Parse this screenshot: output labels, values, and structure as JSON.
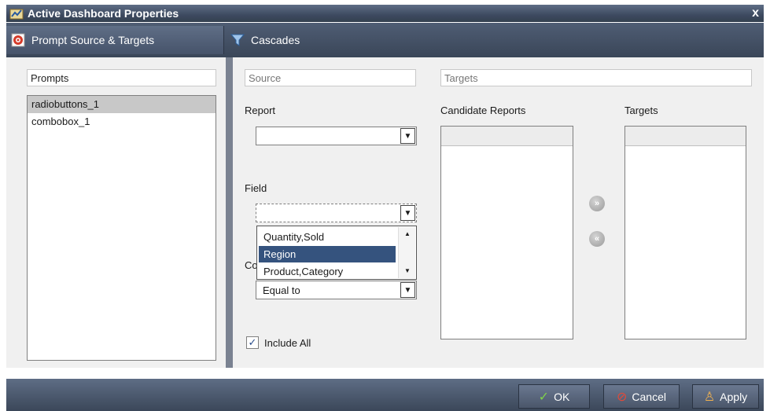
{
  "window": {
    "title": "Active Dashboard Properties",
    "close_glyph": "x"
  },
  "tabs": [
    {
      "label": "Prompt Source & Targets",
      "icon": "target-icon",
      "active": true
    },
    {
      "label": "Cascades",
      "icon": "funnel-icon",
      "active": false
    }
  ],
  "prompts": {
    "header": "Prompts",
    "items": [
      "radiobuttons_1",
      "combobox_1"
    ],
    "selected": "radiobuttons_1"
  },
  "source": {
    "header": "Source",
    "report_label": "Report",
    "report_value": "",
    "field_label": "Field",
    "field_value": "",
    "field_options": [
      "Quantity,Sold",
      "Region",
      "Product,Category"
    ],
    "field_highlighted": "Region",
    "condition_label_partial": "Co",
    "condition_value": "Equal to",
    "include_all_label": "Include All",
    "include_all_checked": true,
    "arrow_glyph": "▼",
    "scroll_up_glyph": "▲",
    "scroll_down_glyph": "▼",
    "check_glyph": "✓"
  },
  "targets": {
    "header": "Targets",
    "candidate_label": "Candidate Reports",
    "targets_label": "Targets",
    "add_glyph": "»",
    "remove_glyph": "«"
  },
  "footer": {
    "ok_label": "OK",
    "cancel_label": "Cancel",
    "apply_label": "Apply",
    "ok_glyph": "✓",
    "cancel_glyph": "⊘",
    "apply_glyph": "♙"
  },
  "colors": {
    "accent": "#35537e",
    "chrome": "#4a566a"
  }
}
